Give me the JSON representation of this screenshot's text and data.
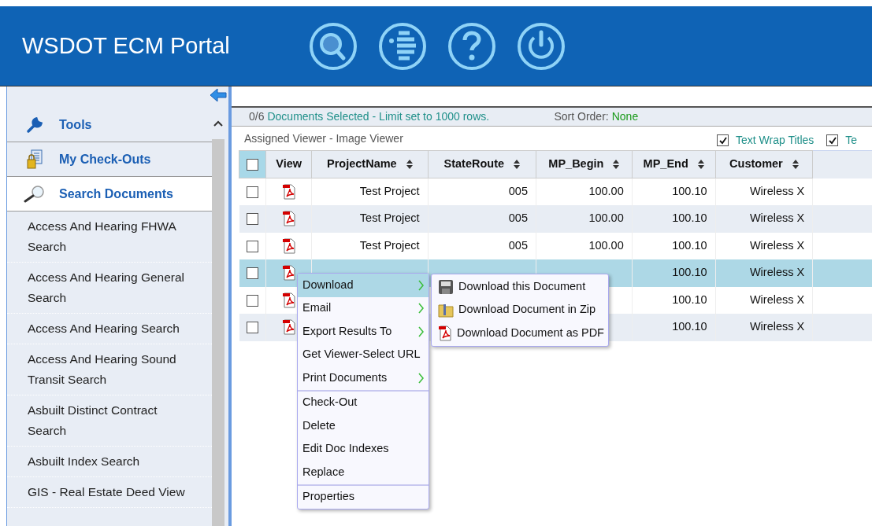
{
  "header": {
    "title": "WSDOT ECM Portal"
  },
  "sidebar": {
    "nav": [
      {
        "label": "Tools",
        "selected": false
      },
      {
        "label": "My Check-Outs",
        "selected": false
      },
      {
        "label": "Search Documents",
        "selected": true
      }
    ],
    "searches": [
      "Access And Hearing FHWA Search",
      "Access And Hearing General Search",
      "Access And Hearing Search",
      "Access And Hearing Sound Transit Search",
      "Asbuilt Distinct Contract Search",
      "Asbuilt Index Search",
      "GIS - Real Estate Deed View"
    ]
  },
  "status_bar": {
    "count": "0/6",
    "message": "Documents Selected - Limit set to 1000 rows.",
    "sort_label": "Sort Order:",
    "sort_value": "None"
  },
  "viewer_label": "Assigned Viewer - Image Viewer",
  "options": [
    {
      "label": "Text Wrap Titles",
      "checked": true
    },
    {
      "label": "Te",
      "checked": true
    }
  ],
  "table": {
    "select_all": {
      "checked": false
    },
    "columns": [
      "View",
      "ProjectName",
      "StateRoute",
      "MP_Begin",
      "MP_End",
      "Customer"
    ],
    "rows": [
      {
        "selected": false,
        "checked": false,
        "cells": [
          "",
          "Test Project",
          "005",
          "100.00",
          "100.10",
          "Wireless X"
        ]
      },
      {
        "selected": false,
        "checked": false,
        "cells": [
          "",
          "Test Project",
          "005",
          "100.00",
          "100.10",
          "Wireless X"
        ]
      },
      {
        "selected": false,
        "checked": false,
        "cells": [
          "",
          "Test Project",
          "005",
          "100.00",
          "100.10",
          "Wireless X"
        ]
      },
      {
        "selected": true,
        "checked": false,
        "cells": [
          "",
          null,
          null,
          null,
          "100.10",
          "Wireless X"
        ]
      },
      {
        "selected": false,
        "checked": false,
        "cells": [
          "",
          null,
          null,
          null,
          "100.10",
          "Wireless X"
        ]
      },
      {
        "selected": false,
        "checked": false,
        "cells": [
          "",
          null,
          null,
          null,
          "100.10",
          "Wireless X"
        ]
      }
    ]
  },
  "context_menu": {
    "groups": [
      [
        {
          "label": "Download",
          "submenu": true,
          "selected": true
        },
        {
          "label": "Email",
          "submenu": true,
          "selected": false
        },
        {
          "label": "Export Results To",
          "submenu": true,
          "selected": false
        },
        {
          "label": "Get Viewer-Select URL",
          "submenu": false,
          "selected": false
        },
        {
          "label": "Print Documents",
          "submenu": true,
          "selected": false
        }
      ],
      [
        {
          "label": "Check-Out",
          "submenu": false,
          "selected": false
        },
        {
          "label": "Delete",
          "submenu": false,
          "selected": false
        },
        {
          "label": "Edit Doc Indexes",
          "submenu": false,
          "selected": false
        },
        {
          "label": "Replace",
          "submenu": false,
          "selected": false
        }
      ],
      [
        {
          "label": "Properties",
          "submenu": false,
          "selected": false
        }
      ]
    ]
  },
  "submenu": [
    "Download this Document",
    "Download Document in Zip",
    "Download Document as PDF"
  ]
}
